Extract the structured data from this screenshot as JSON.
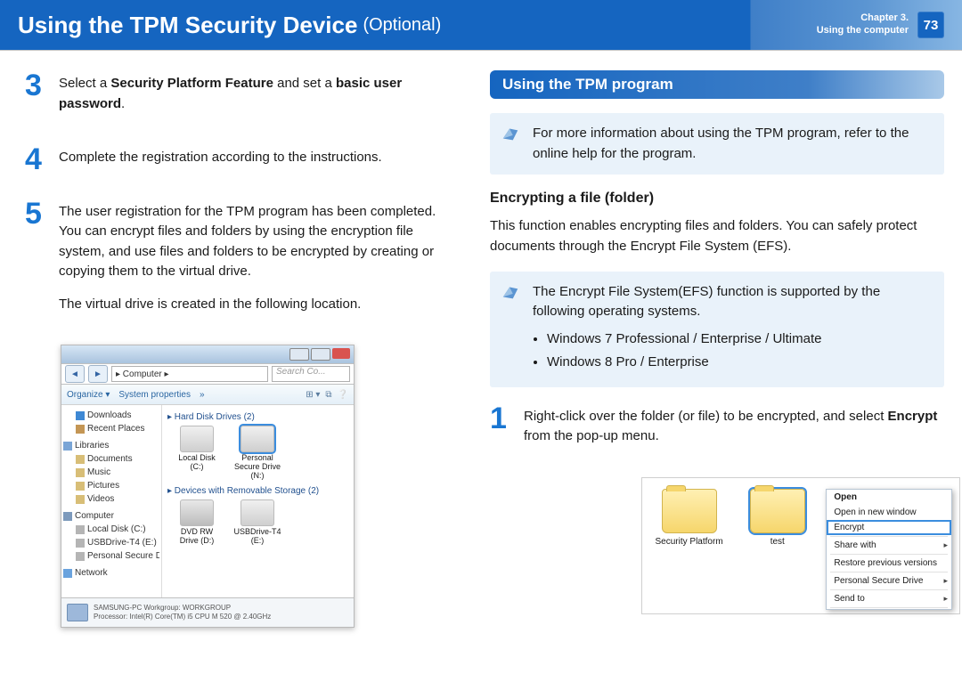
{
  "header": {
    "title": "Using the TPM Security Device",
    "optional": "(Optional)",
    "chapter_line1": "Chapter 3.",
    "chapter_line2": "Using the computer",
    "page_number": "73"
  },
  "left": {
    "steps": {
      "s3": {
        "num": "3",
        "text_a": "Select a ",
        "text_b": "Security Platform Feature",
        "text_c": " and set a ",
        "text_d": "basic user password",
        "text_e": "."
      },
      "s4": {
        "num": "4",
        "text": "Complete the registration according to the instructions."
      },
      "s5": {
        "num": "5",
        "p1": "The user registration for the TPM program has been completed. You can encrypt files and folders by using the encryption file system, and use files and folders to be encrypted by creating or copying them to the virtual drive.",
        "p2": "The virtual drive is created in the following location."
      }
    },
    "explorer": {
      "address": "  ▸ Computer  ▸",
      "search_placeholder": "Search Co...",
      "toolbar": {
        "organize": "Organize ▾",
        "sysprops": "System properties",
        "right1": "⊞ ▾",
        "right2": "⧉",
        "right3": "❔"
      },
      "sidebar": {
        "downloads": "Downloads",
        "recent": "Recent Places",
        "libraries": "Libraries",
        "documents": "Documents",
        "music": "Music",
        "pictures": "Pictures",
        "videos": "Videos",
        "computer": "Computer",
        "localc": "Local Disk (C:)",
        "usb_t4": "USBDrive-T4 (E:)",
        "psd": "Personal Secure D",
        "network": "Network"
      },
      "main": {
        "group1": "▸ Hard Disk Drives (2)",
        "drive_c": "Local Disk (C:)",
        "drive_psd": "Personal Secure Drive (N:)",
        "group2": "▸ Devices with Removable Storage (2)",
        "drive_dvd": "DVD RW Drive (D:)",
        "drive_usb": "USBDrive-T4 (E:)"
      },
      "status": {
        "line1": "SAMSUNG-PC   Workgroup:  WORKGROUP",
        "line2": "Processor:  Intel(R) Core(TM) i5 CPU       M 520  @ 2.40GHz"
      }
    }
  },
  "right": {
    "section_title": "Using the TPM program",
    "tip1": "For more information about using the TPM program, refer to the online help for the program.",
    "sub1": "Encrypting a file (folder)",
    "para1": "This function enables encrypting files and folders. You can safely protect documents through the Encrypt File System (EFS).",
    "tip2_lead": "The Encrypt File System(EFS) function is supported by the following operating systems.",
    "tip2_items": [
      "Windows 7 Professional / Enterprise / Ultimate",
      "Windows 8 Pro / Enterprise"
    ],
    "step1": {
      "num": "1",
      "text_a": "Right-click over the folder (or file) to be encrypted, and select ",
      "text_b": "Encrypt",
      "text_c": " from the pop-up menu."
    },
    "ctx": {
      "folder1": "Security Platform",
      "folder2": "test",
      "menu": {
        "open": "Open",
        "open_new": "Open in new window",
        "encrypt": "Encrypt",
        "share": "Share with",
        "restore": "Restore previous versions",
        "psd": "Personal Secure Drive",
        "sendto": "Send to"
      }
    }
  }
}
